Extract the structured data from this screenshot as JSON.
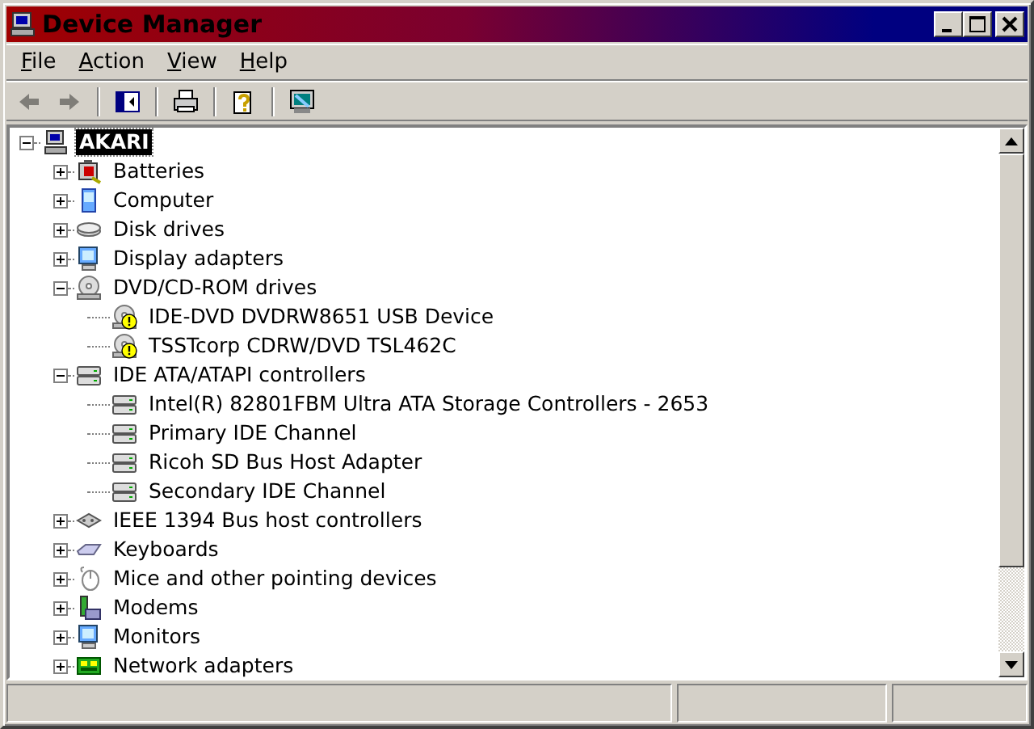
{
  "window": {
    "title": "Device Manager"
  },
  "menu": [
    {
      "label": "File"
    },
    {
      "label": "Action"
    },
    {
      "label": "View"
    },
    {
      "label": "Help"
    }
  ],
  "toolbar": [
    {
      "kind": "back",
      "disabled": true
    },
    {
      "kind": "forward",
      "disabled": true
    },
    {
      "kind": "separator"
    },
    {
      "kind": "tree",
      "disabled": false
    },
    {
      "kind": "separator"
    },
    {
      "kind": "print",
      "disabled": false
    },
    {
      "kind": "separator"
    },
    {
      "kind": "help",
      "disabled": false
    },
    {
      "kind": "separator"
    },
    {
      "kind": "scan",
      "disabled": false
    }
  ],
  "tree": [
    {
      "label": "AKARI",
      "kind": "computer",
      "expanded": true,
      "selected": true,
      "children": [
        {
          "label": "Batteries",
          "kind": "battery",
          "expanded": false,
          "selected": false
        },
        {
          "label": "Computer",
          "kind": "pc",
          "expanded": false,
          "selected": false
        },
        {
          "label": "Disk drives",
          "kind": "disk",
          "expanded": false,
          "selected": false
        },
        {
          "label": "Display adapters",
          "kind": "display",
          "expanded": false,
          "selected": false
        },
        {
          "label": "DVD/CD-ROM drives",
          "kind": "dvd",
          "expanded": true,
          "selected": false,
          "children": [
            {
              "label": "IDE-DVD DVDRW8651 USB Device",
              "kind": "dvd",
              "warning": true,
              "selected": false
            },
            {
              "label": "TSSTcorp CDRW/DVD TSL462C",
              "kind": "dvd",
              "warning": true,
              "selected": false
            }
          ]
        },
        {
          "label": "IDE ATA/ATAPI controllers",
          "kind": "controller",
          "expanded": true,
          "selected": false,
          "children": [
            {
              "label": "Intel(R) 82801FBM Ultra ATA Storage Controllers - 2653",
              "kind": "controller",
              "warning": false,
              "selected": false
            },
            {
              "label": "Primary IDE Channel",
              "kind": "controller",
              "warning": false,
              "selected": false
            },
            {
              "label": "Ricoh SD Bus Host Adapter",
              "kind": "controller",
              "warning": false,
              "selected": false
            },
            {
              "label": "Secondary IDE Channel",
              "kind": "controller",
              "warning": false,
              "selected": false
            }
          ]
        },
        {
          "label": "IEEE 1394 Bus host controllers",
          "kind": "bus",
          "expanded": false,
          "selected": false
        },
        {
          "label": "Keyboards",
          "kind": "keyboard",
          "expanded": false,
          "selected": false
        },
        {
          "label": "Mice and other pointing devices",
          "kind": "mouse",
          "expanded": false,
          "selected": false
        },
        {
          "label": "Modems",
          "kind": "modem",
          "expanded": false,
          "selected": false
        },
        {
          "label": "Monitors",
          "kind": "display",
          "expanded": false,
          "selected": false
        },
        {
          "label": "Network adapters",
          "kind": "network",
          "expanded": false,
          "selected": false
        }
      ]
    }
  ]
}
